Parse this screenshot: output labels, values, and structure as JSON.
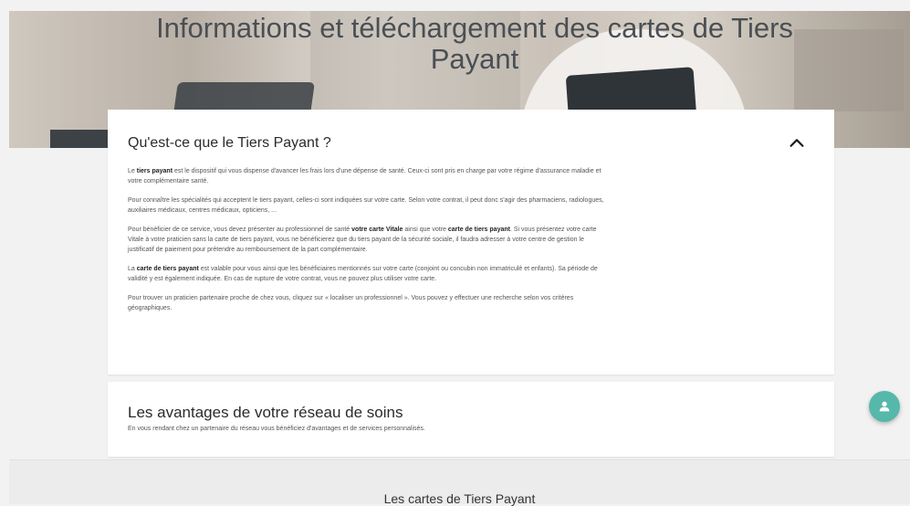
{
  "hero": {
    "title": "Informations et téléchargement des cartes de Tiers Payant"
  },
  "sections": [
    {
      "title": "Qu'est-ce que le Tiers Payant ?",
      "expanded": true,
      "paragraphs": [
        {
          "parts": [
            {
              "t": "Le "
            },
            {
              "b": "tiers payant"
            },
            {
              "t": " est le dispositif qui vous dispense d'avancer les frais lors d'une dépense de santé. Ceux-ci sont pris en charge par votre régime d'assurance maladie et votre complémentaire santé."
            }
          ]
        },
        {
          "parts": [
            {
              "t": "Pour connaître les spécialités qui acceptent le tiers payant, celles-ci sont indiquées sur votre carte. Selon votre contrat, il peut donc s'agir des pharmaciens, radiologues, auxiliaires médicaux, centres médicaux, opticiens, ..."
            }
          ]
        },
        {
          "parts": [
            {
              "t": "Pour bénéficier de ce service, vous devez présenter au professionnel de santé "
            },
            {
              "b": "votre carte Vitale"
            },
            {
              "t": " ainsi que votre "
            },
            {
              "b": "carte de tiers payant"
            },
            {
              "t": ". Si vous présentez votre carte Vitale à votre praticien sans la carte de tiers payant, vous ne bénéficierez que du tiers payant de la sécurité sociale, il faudra adresser à votre centre de gestion le justificatif de paiement pour prétendre au remboursement de la part complémentaire."
            }
          ]
        },
        {
          "parts": [
            {
              "t": "La "
            },
            {
              "b": "carte de tiers payant"
            },
            {
              "t": " est valable pour vous ainsi que les bénéficiaires mentionnés sur votre carte (conjoint ou concubin non immatriculé et enfants). Sa période de validité y est également indiquée. En cas de rupture de votre contrat, vous ne pouvez plus utiliser votre carte."
            }
          ]
        },
        {
          "parts": [
            {
              "t": "Pour trouver un praticien partenaire proche de chez vous, cliquez sur « localiser un professionnel ». Vous pouvez y effectuer une recherche selon vos critères géographiques."
            }
          ]
        }
      ]
    },
    {
      "title": "Les avantages de votre réseau de soins",
      "subtitle": "En vous rendant chez un partenaire du réseau vous bénéficiez d'avantages et de services personnalisés."
    }
  ],
  "fab": {
    "icon": "user-icon",
    "color": "#55b8aa"
  },
  "bottom": {
    "heading": "Les cartes de Tiers Payant"
  }
}
